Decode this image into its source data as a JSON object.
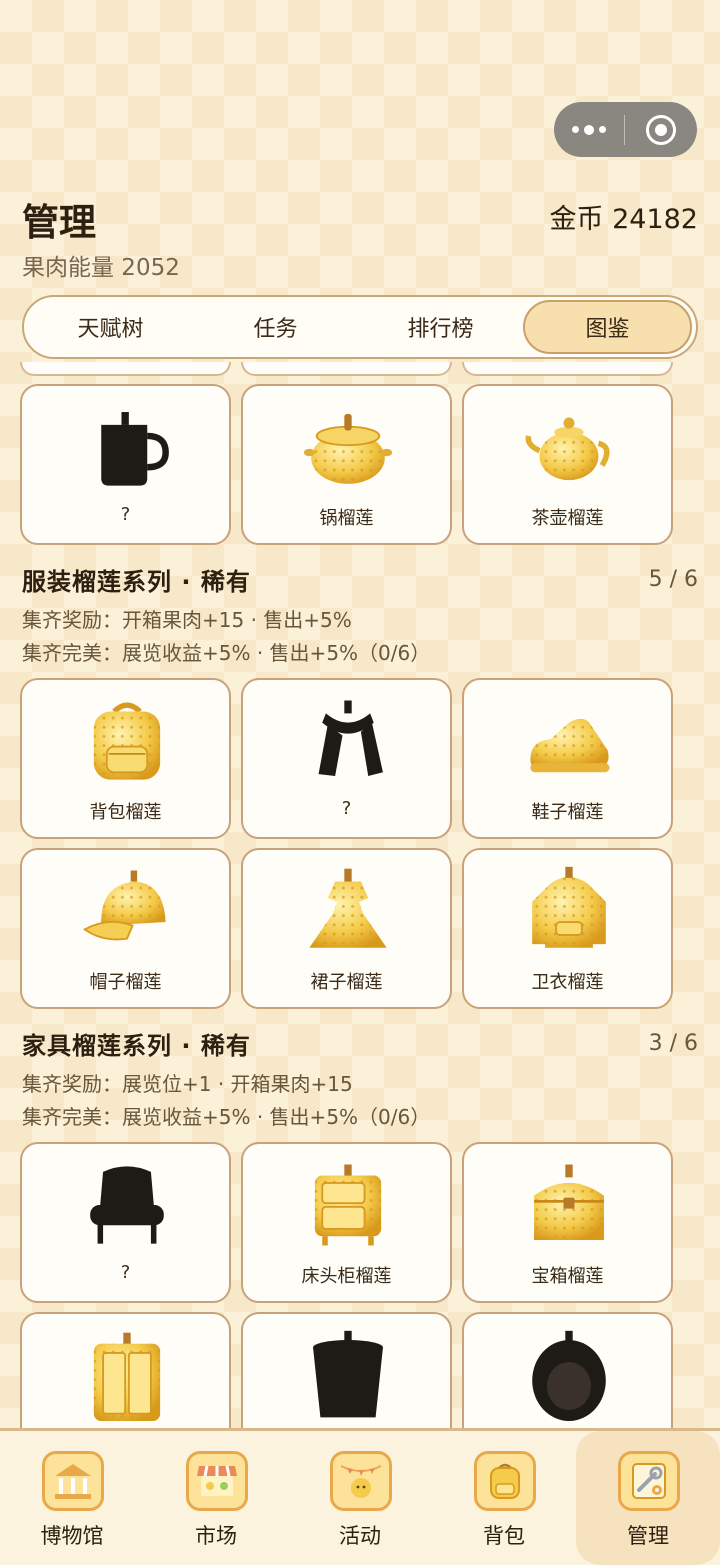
{
  "header": {
    "title": "管理",
    "coins_label": "金币 24182",
    "energy_label": "果肉能量 2052"
  },
  "tabs": [
    {
      "label": "天赋树",
      "active": false
    },
    {
      "label": "任务",
      "active": false
    },
    {
      "label": "排行榜",
      "active": false
    },
    {
      "label": "图鉴",
      "active": true
    }
  ],
  "top_row": [
    {
      "name": "?",
      "icon": "mug-silhouette-icon",
      "unlocked": false
    },
    {
      "name": "锅榴莲",
      "icon": "pot-durian-icon",
      "unlocked": true
    },
    {
      "name": "茶壶榴莲",
      "icon": "teapot-durian-icon",
      "unlocked": true
    }
  ],
  "sections": [
    {
      "title": "服装榴莲系列 · 稀有",
      "count": "5 / 6",
      "reward": "集齐奖励：开箱果肉+15 · 售出+5%",
      "perfect": "集齐完美：展览收益+5% · 售出+5%（0/6）",
      "items": [
        {
          "name": "背包榴莲",
          "icon": "backpack-durian-icon",
          "unlocked": true
        },
        {
          "name": "?",
          "icon": "scarf-silhouette-icon",
          "unlocked": false
        },
        {
          "name": "鞋子榴莲",
          "icon": "shoe-durian-icon",
          "unlocked": true
        },
        {
          "name": "帽子榴莲",
          "icon": "cap-durian-icon",
          "unlocked": true
        },
        {
          "name": "裙子榴莲",
          "icon": "dress-durian-icon",
          "unlocked": true
        },
        {
          "name": "卫衣榴莲",
          "icon": "hoodie-durian-icon",
          "unlocked": true
        }
      ]
    },
    {
      "title": "家具榴莲系列 · 稀有",
      "count": "3 / 6",
      "reward": "集齐奖励：展览位+1 · 开箱果肉+15",
      "perfect": "集齐完美：展览收益+5% · 售出+5%（0/6）",
      "items": [
        {
          "name": "?",
          "icon": "armchair-silhouette-icon",
          "unlocked": false
        },
        {
          "name": "床头柜榴莲",
          "icon": "nightstand-durian-icon",
          "unlocked": true
        },
        {
          "name": "宝箱榴莲",
          "icon": "chest-durian-icon",
          "unlocked": true
        },
        {
          "name": "",
          "icon": "wardrobe-durian-icon",
          "unlocked": true
        },
        {
          "name": "",
          "icon": "basket-silhouette-icon",
          "unlocked": false
        },
        {
          "name": "",
          "icon": "egg-chair-silhouette-icon",
          "unlocked": false
        }
      ]
    }
  ],
  "bottom_nav": [
    {
      "label": "博物馆",
      "icon": "museum-icon",
      "active": false
    },
    {
      "label": "市场",
      "icon": "market-stall-icon",
      "active": false
    },
    {
      "label": "活动",
      "icon": "event-icon",
      "active": false
    },
    {
      "label": "背包",
      "icon": "backpack-icon",
      "active": false
    },
    {
      "label": "管理",
      "icon": "settings-wrench-icon",
      "active": true
    }
  ],
  "colors": {
    "accent_gold": "#f2c53d",
    "silhouette": "#1e1a16",
    "card_border": "#c8a27a",
    "background": "#fbf1d8"
  }
}
